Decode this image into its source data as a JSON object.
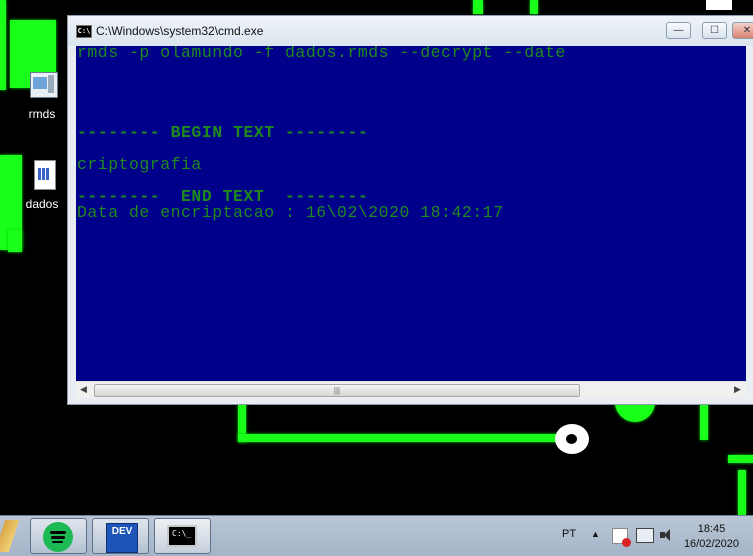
{
  "desktop": {
    "icons": [
      {
        "label": "rmds",
        "icon": "app-icon"
      },
      {
        "label": "dados",
        "icon": "document-icon"
      }
    ]
  },
  "window": {
    "title": "C:\\Windows\\system32\\cmd.exe",
    "app_icon_text": "C:\\",
    "controls": {
      "minimize": "—",
      "maximize": "☐",
      "close": "✕"
    },
    "background": "#00008a",
    "text_color": "#1e8a1e",
    "lines": [
      "rmds -p olamundo -f dados.rmds --decrypt --date",
      "-------- BEGIN TEXT --------",
      "criptografia",
      "--------  END TEXT  --------",
      "Data de encriptacao : 16\\02\\2020 18:42:17"
    ],
    "hscroll": {
      "left_arrow": "◀",
      "right_arrow": "▶",
      "grip": "|||"
    }
  },
  "taskbar": {
    "buttons": [
      {
        "name": "spotify",
        "icon": "spotify-icon"
      },
      {
        "name": "dev-cpp",
        "icon": "dev-icon",
        "text": "DEV"
      },
      {
        "name": "cmd",
        "icon": "cmd-icon",
        "text": "C:\\_"
      }
    ],
    "language": "PT",
    "tray_arrow": "▲",
    "time": "18:45",
    "date": "16/02/2020"
  }
}
